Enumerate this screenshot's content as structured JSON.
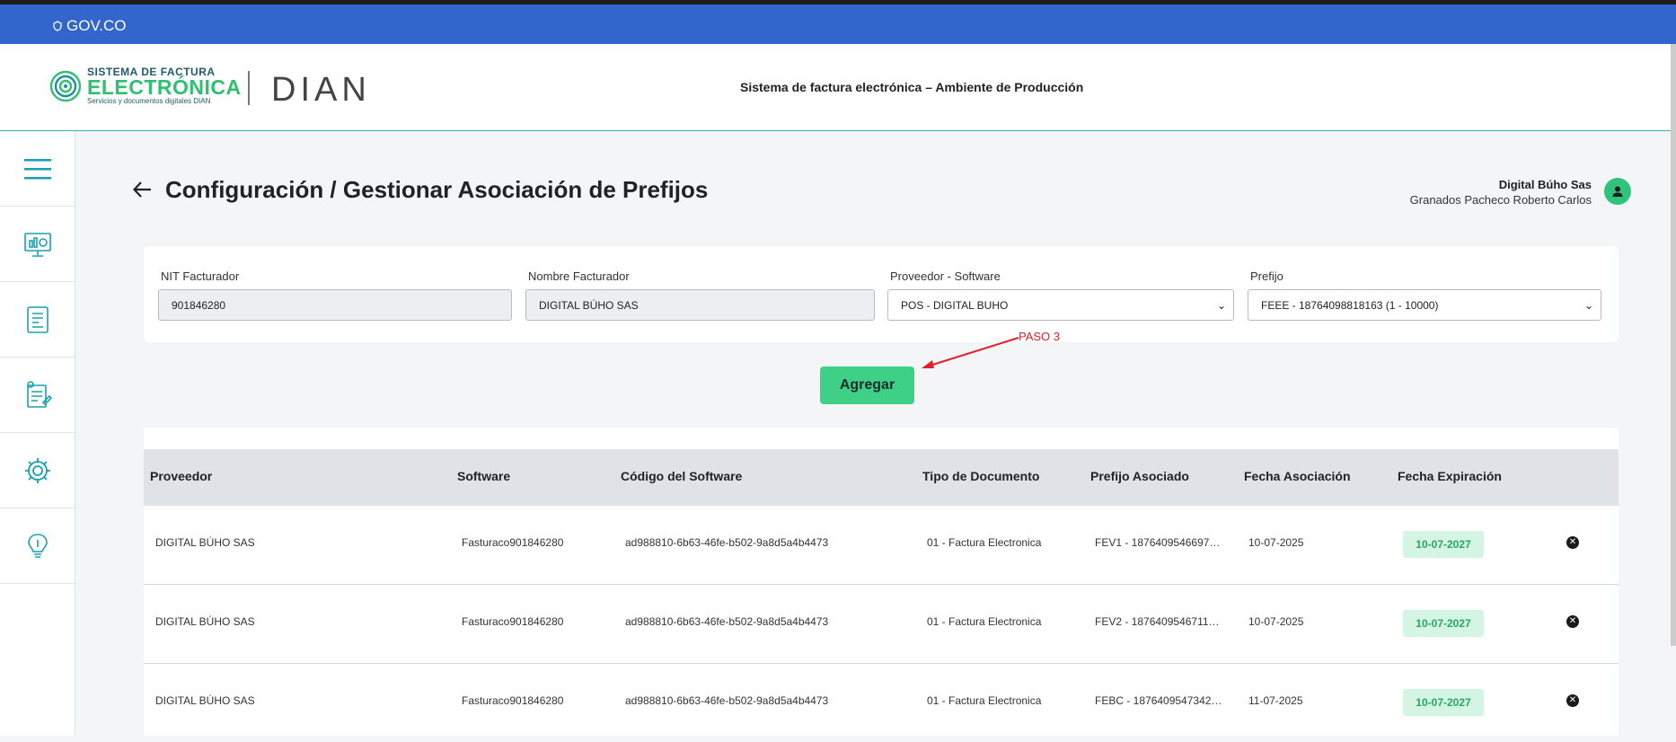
{
  "gov": {
    "label": "GOV.CO"
  },
  "header": {
    "logo_line1": "SISTEMA DE FACTURA",
    "logo_line2": "ELECTRÓNICA",
    "logo_line3": "Servicios y documentos digitales DIAN",
    "dian": "DIAN",
    "title": "Sistema de factura electrónica – Ambiente de Producción"
  },
  "sidebar": {
    "items": [
      {
        "icon": "menu-icon"
      },
      {
        "icon": "dashboard-icon"
      },
      {
        "icon": "document-icon"
      },
      {
        "icon": "reports-icon"
      },
      {
        "icon": "settings-icon"
      },
      {
        "icon": "help-icon"
      }
    ]
  },
  "page": {
    "title": "Configuración / Gestionar Asociación de Prefijos"
  },
  "user": {
    "company": "Digital Búho Sas",
    "name": "Granados Pacheco Roberto Carlos"
  },
  "form": {
    "nit_label": "NIT Facturador",
    "nit_value": "901846280",
    "nombre_label": "Nombre Facturador",
    "nombre_value": "DIGITAL BÚHO SAS",
    "proveedor_label": "Proveedor - Software",
    "proveedor_value": "POS - DIGITAL BUHO",
    "prefijo_label": "Prefijo",
    "prefijo_value": "FEEE - 18764098818163 (1 - 10000)"
  },
  "actions": {
    "add_label": "Agregar"
  },
  "annotation": {
    "text": "PASO 3",
    "color": "#e0202a"
  },
  "table": {
    "headers": [
      "Proveedor",
      "Software",
      "Código del Software",
      "Tipo de Documento",
      "Prefijo Asociado",
      "Fecha Asociación",
      "Fecha Expiración"
    ],
    "rows": [
      {
        "proveedor": "DIGITAL BÚHO SAS",
        "software": "Fasturaco901846280",
        "codigo": "ad988810-6b63-46fe-b502-9a8d5a4b4473",
        "tipo": "01 - Factura Electronica",
        "prefijo": "FEV1 - 1876409546697…",
        "asociacion": "10-07-2025",
        "expiracion": "10-07-2027"
      },
      {
        "proveedor": "DIGITAL BÚHO SAS",
        "software": "Fasturaco901846280",
        "codigo": "ad988810-6b63-46fe-b502-9a8d5a4b4473",
        "tipo": "01 - Factura Electronica",
        "prefijo": "FEV2 - 1876409546711…",
        "asociacion": "10-07-2025",
        "expiracion": "10-07-2027"
      },
      {
        "proveedor": "DIGITAL BÚHO SAS",
        "software": "Fasturaco901846280",
        "codigo": "ad988810-6b63-46fe-b502-9a8d5a4b4473",
        "tipo": "01 - Factura Electronica",
        "prefijo": "FEBC - 1876409547342…",
        "asociacion": "11-07-2025",
        "expiracion": "10-07-2027"
      }
    ]
  },
  "colors": {
    "gov_blue": "#3366cc",
    "accent_green": "#3fd088",
    "teal": "#1a9fb0"
  }
}
